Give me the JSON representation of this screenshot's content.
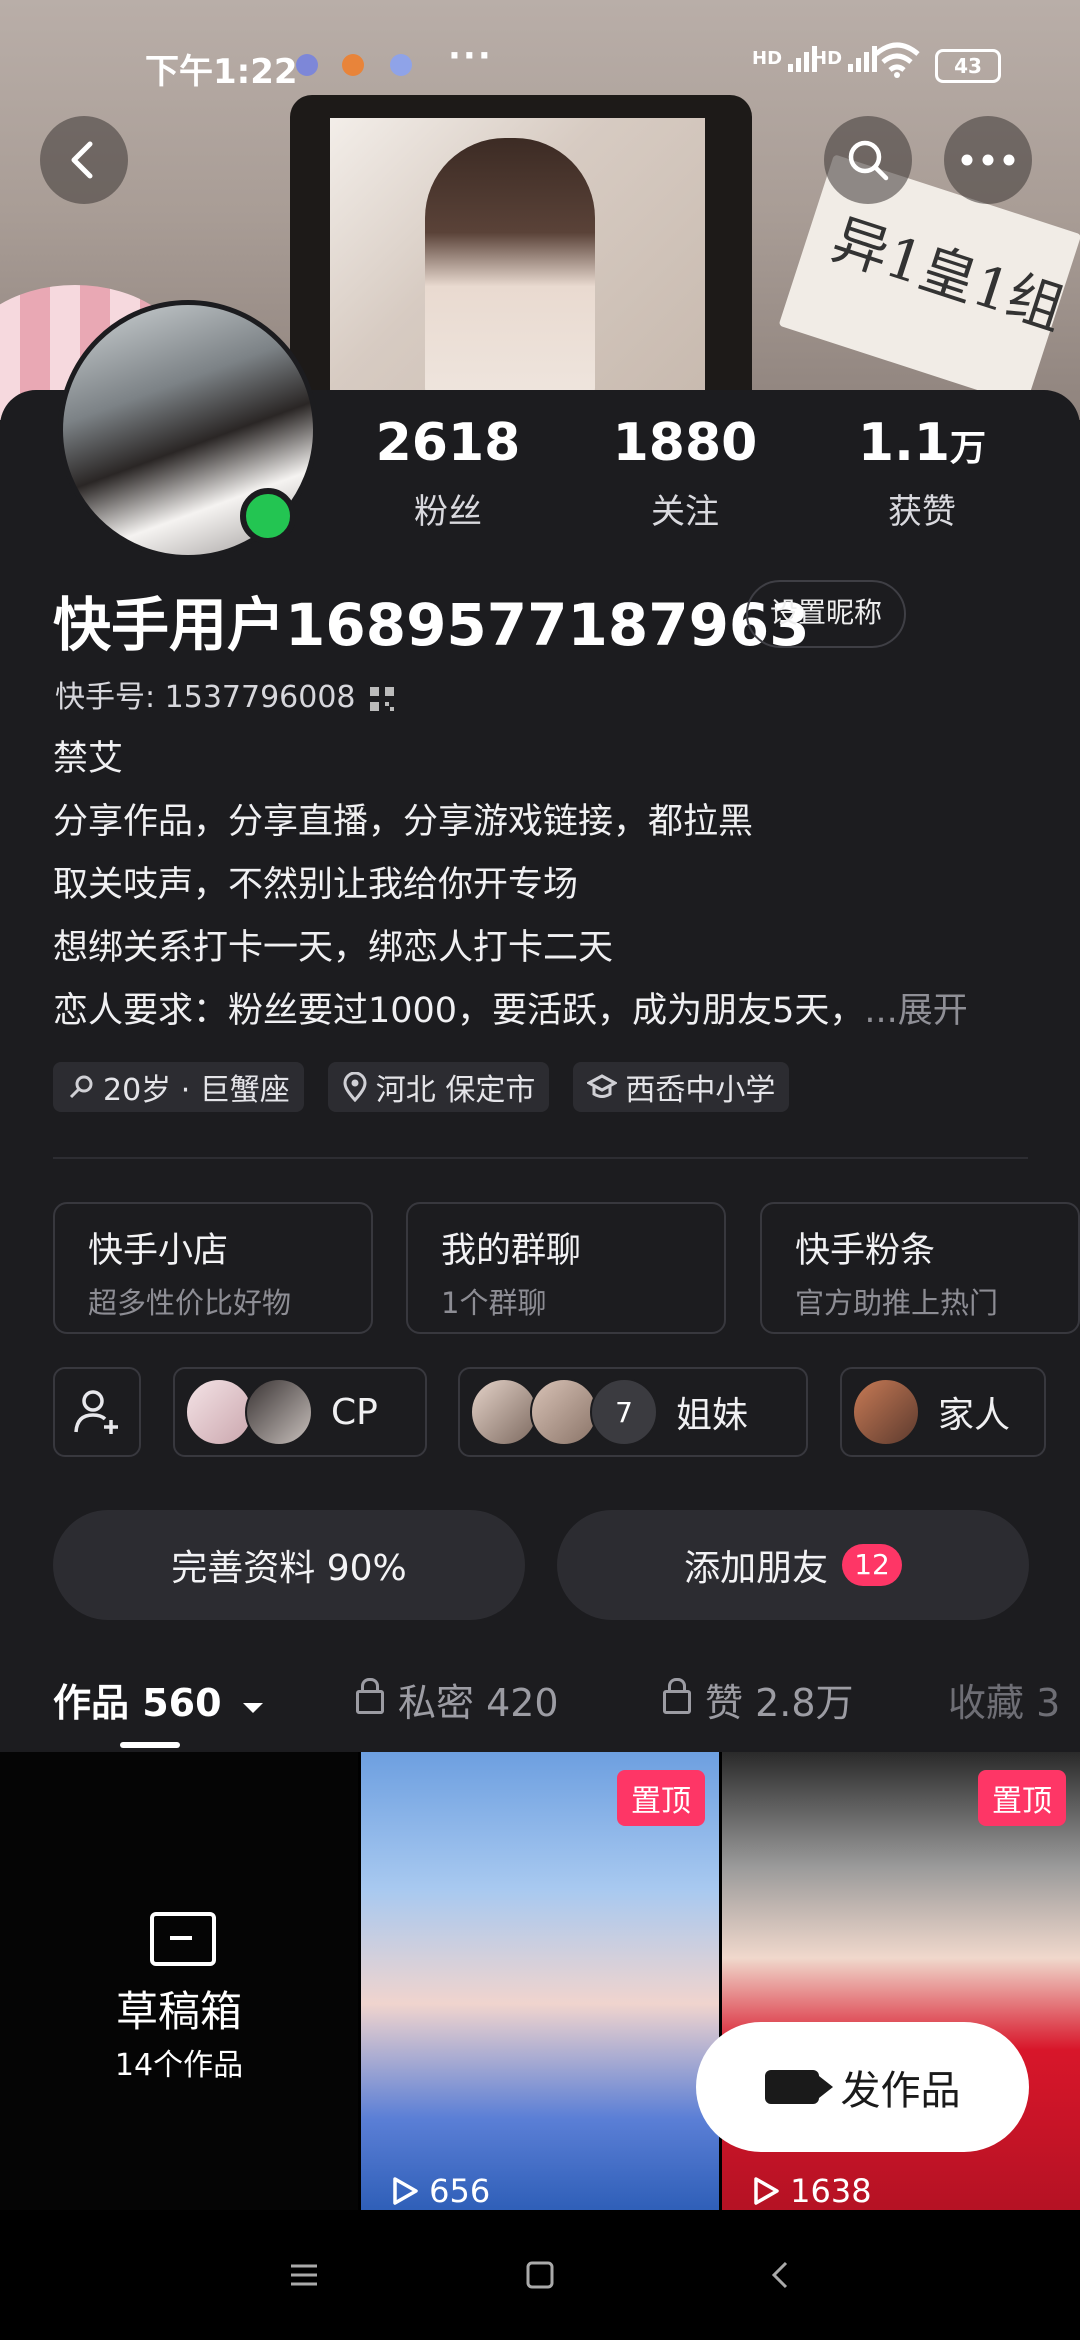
{
  "status_bar": {
    "time": "下午1:22",
    "more": "···",
    "hd": "HD",
    "battery": "43"
  },
  "cover": {
    "paper_text": "异1皇1组"
  },
  "stats": [
    {
      "num": "2618",
      "unit": "",
      "label": "粉丝"
    },
    {
      "num": "1880",
      "unit": "",
      "label": "关注"
    },
    {
      "num": "1.1",
      "unit": "万",
      "label": "获赞"
    }
  ],
  "profile": {
    "nickname": "快手用户1689577187963",
    "set_nickname": "设置昵称",
    "kid": "快手号: 1537796008"
  },
  "bio": {
    "line1": "禁艾",
    "line2": "分享作品，分享直播，分享游戏链接，都拉黑",
    "line3": "取关吱声，不然别让我给你开专场",
    "line4": "想绑关系打卡一天，绑恋人打卡二天",
    "line5": "恋人要求：粉丝要过1000，要活跃，成为朋友5天，",
    "expand": "...展开"
  },
  "tags": [
    {
      "icon": "gender-icon",
      "text": "20岁 · 巨蟹座"
    },
    {
      "icon": "location-icon",
      "text": "河北 保定市"
    },
    {
      "icon": "school-icon",
      "text": "西岙中小学"
    }
  ],
  "services": [
    {
      "title": "快手小店",
      "sub": "超多性价比好物"
    },
    {
      "title": "我的群聊",
      "sub": "1个群聊"
    },
    {
      "title": "快手粉条",
      "sub": "官方助推上热门"
    }
  ],
  "groups": [
    {
      "label": "CP"
    },
    {
      "label": "姐妹",
      "count": "7"
    },
    {
      "label": "家人"
    }
  ],
  "actions": {
    "complete": "完善资料 90%",
    "add_friend": "添加朋友",
    "add_friend_badge": "12"
  },
  "tabs": [
    {
      "label": "作品 560"
    },
    {
      "label": "私密 420"
    },
    {
      "label": "赞 2.8万"
    },
    {
      "label": "收藏 3"
    }
  ],
  "grid": {
    "draft_title": "草稿箱",
    "draft_sub": "14个作品",
    "pin_label": "置顶",
    "videos": [
      {
        "plays": "656"
      },
      {
        "plays": "1638"
      }
    ]
  },
  "publish": {
    "label": "发作品"
  }
}
